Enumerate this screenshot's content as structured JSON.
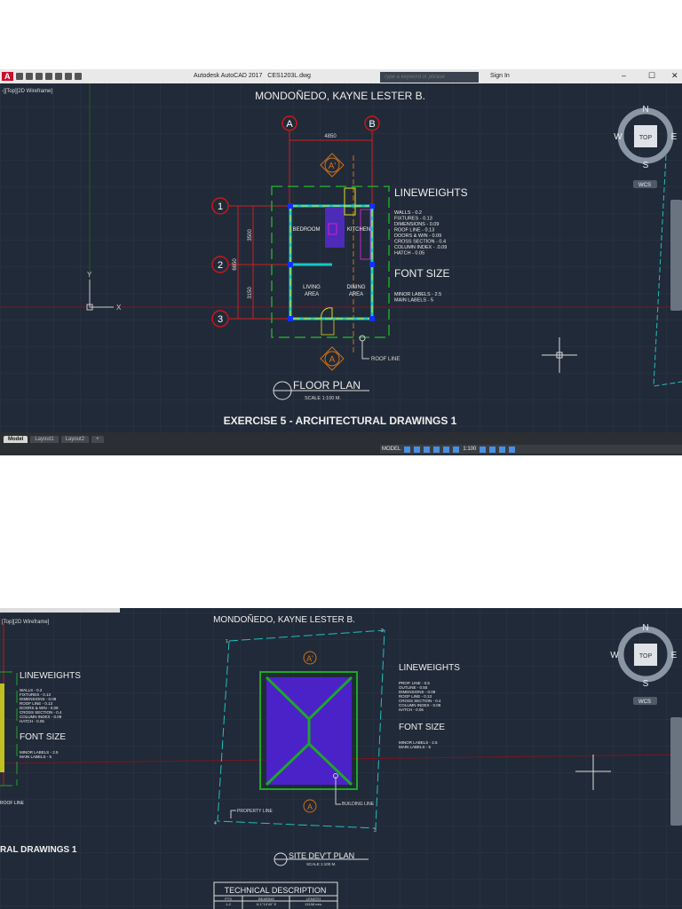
{
  "top": {
    "app_title": "Autodesk AutoCAD 2017",
    "file_name": "CES1203L.dwg",
    "search_placeholder": "Type a keyword or phrase",
    "sign_in": "Sign In",
    "viewport_label": "-][Top][2D Wireframe]",
    "author": "MONDOÑEDO, KAYNE LESTER B.",
    "grid_cols": [
      "A",
      "B"
    ],
    "grid_rows": [
      "1",
      "2",
      "3"
    ],
    "dims": {
      "width": "4850",
      "top": "3500",
      "bottom": "3150",
      "total": "6650"
    },
    "section_marks": [
      "A'",
      "A"
    ],
    "rooms": [
      "BEDROOM",
      "KITCHEN",
      "LIVING",
      "AREA",
      "DINING",
      "AREA"
    ],
    "roof_line": "ROOF LINE",
    "lineweights_title": "LINEWEIGHTS",
    "lineweights": [
      "WALLS - 0.2",
      "FIXTURES - 0.13",
      "DIMENSIONS - 0.09",
      "ROOF LINE - 0.13",
      "DOORS & WIN - 0.09",
      "CROSS SECTION - 0.4",
      "COLUMN INDEX - .0.09",
      "HATCH - 0.05"
    ],
    "font_size_title": "FONT SIZE",
    "font_sizes": [
      "MINOR LABELS - 2.5",
      "MAIN LABELS - 5"
    ],
    "plan_title": "FLOOR PLAN",
    "plan_scale": "SCALE 1:100 M.",
    "sheet_title": "EXERCISE 5 - ARCHITECTURAL DRAWINGS 1",
    "compass": {
      "n": "N",
      "s": "S",
      "e": "E",
      "w": "W",
      "top": "TOP",
      "wcs": "WCS"
    },
    "ucs": {
      "x": "X",
      "y": "Y"
    },
    "tabs": [
      "Model",
      "Layout1",
      "Layout2",
      "+"
    ],
    "status_model": "MODEL",
    "status_scale": "1:100"
  },
  "bottom": {
    "viewport_label": "[Top][2D Wireframe]",
    "author": "MONDOÑEDO, KAYNE LESTER B.",
    "left_lineweights_title": "LINEWEIGHTS",
    "left_lineweights": [
      "WALLS - 0.2",
      "FIXTURES - 0.13",
      "DIMENSIONS - 0.09",
      "ROOF LINE - 0.13",
      "DOORS & WIN - 0.09",
      "CROSS SECTION - 0.4",
      "COLUMN INDEX - 0.09",
      "HATCH - 0.05"
    ],
    "left_font_size_title": "FONT SIZE",
    "left_font_sizes": [
      "MINOR LABELS - 2.5",
      "MAIN LABELS - 5"
    ],
    "left_roof_line": "ROOF LINE",
    "left_sheet_title": "RAL DRAWINGS 1",
    "lineweights_title": "LINEWEIGHTS",
    "lineweights": [
      "PROP. LINE - 0.5",
      "OUTLINE - 0.50",
      "DIMENSIONS - 0.09",
      "ROOF LINE - 0.13",
      "CROSS SECTION - 0.4",
      "COLUMN INDEX - 0.09",
      "HATCH - 0.05"
    ],
    "font_size_title": "FONT SIZE",
    "font_sizes": [
      "MINOR LABELS - 2.5",
      "MAIN LABELS - 5"
    ],
    "property_line": "PROPERTY LINE",
    "building_line": "BUILDING LINE",
    "section_marks": [
      "A'",
      "A"
    ],
    "points": [
      "1",
      "2",
      "3",
      "4"
    ],
    "plan_title": "SITE DEV'T PLAN",
    "plan_scale": "SCALE 1:100 M.",
    "table": {
      "title": "TECHNICAL DESCRIPTION",
      "headers": [
        "PTS",
        "BEARING",
        "LENGTH"
      ],
      "row1": [
        "1-2",
        "N 1°10'40\" E",
        "13158 mm."
      ]
    },
    "compass": {
      "n": "N",
      "s": "S",
      "e": "E",
      "w": "W",
      "top": "TOP",
      "wcs": "WCS"
    }
  }
}
